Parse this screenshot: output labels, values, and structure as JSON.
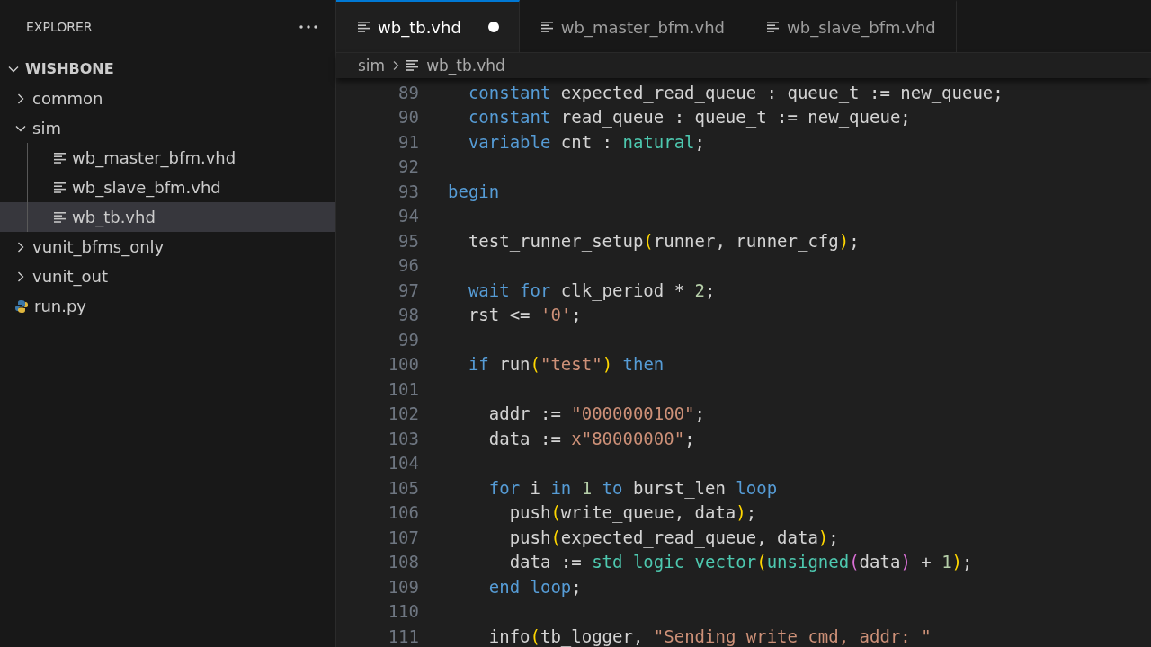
{
  "sidebar": {
    "title": "EXPLORER",
    "tree": {
      "label": "WISHBONE",
      "kind": "root",
      "expanded": true,
      "selected": false,
      "children": [
        {
          "label": "common",
          "kind": "folder",
          "expanded": false,
          "selected": false
        },
        {
          "label": "sim",
          "kind": "folder",
          "expanded": true,
          "selected": false,
          "children": [
            {
              "label": "wb_master_bfm.vhd",
              "kind": "file",
              "selected": false
            },
            {
              "label": "wb_slave_bfm.vhd",
              "kind": "file",
              "selected": false
            },
            {
              "label": "wb_tb.vhd",
              "kind": "file",
              "selected": true
            }
          ]
        },
        {
          "label": "vunit_bfms_only",
          "kind": "folder",
          "expanded": false,
          "selected": false
        },
        {
          "label": "vunit_out",
          "kind": "folder",
          "expanded": false,
          "selected": false
        },
        {
          "label": "run.py",
          "kind": "python",
          "selected": false
        }
      ]
    }
  },
  "tabs": [
    {
      "label": "wb_tb.vhd",
      "selected": true,
      "modified": true
    },
    {
      "label": "wb_master_bfm.vhd",
      "selected": false,
      "modified": false
    },
    {
      "label": "wb_slave_bfm.vhd",
      "selected": false,
      "modified": false
    }
  ],
  "breadcrumb": [
    "sim",
    "wb_tb.vhd"
  ],
  "editor": {
    "lines": [
      {
        "number": "89",
        "tokens": [
          {
            "kind": "keyword",
            "text": "  constant"
          },
          {
            "kind": "plain",
            "text": " expected_read_queue : queue_t := new_queue;"
          }
        ]
      },
      {
        "number": "90",
        "tokens": [
          {
            "kind": "keyword",
            "text": "  constant"
          },
          {
            "kind": "plain",
            "text": " read_queue : queue_t := new_queue;"
          }
        ]
      },
      {
        "number": "91",
        "tokens": [
          {
            "kind": "keyword",
            "text": "  variable"
          },
          {
            "kind": "plain",
            "text": " cnt : "
          },
          {
            "kind": "type",
            "text": "natural"
          },
          {
            "kind": "plain",
            "text": ";"
          }
        ]
      },
      {
        "number": "92"
      },
      {
        "number": "93",
        "tokens": [
          {
            "kind": "keyword",
            "text": "begin"
          }
        ]
      },
      {
        "number": "94"
      },
      {
        "number": "95",
        "tokens": [
          {
            "kind": "plain",
            "text": "  test_runner_setup"
          },
          {
            "kind": "paren",
            "text": "("
          },
          {
            "kind": "plain",
            "text": "runner, runner_cfg"
          },
          {
            "kind": "paren",
            "text": ")"
          },
          {
            "kind": "plain",
            "text": ";"
          }
        ]
      },
      {
        "number": "96"
      },
      {
        "number": "97",
        "tokens": [
          {
            "kind": "keyword",
            "text": "  wait for"
          },
          {
            "kind": "plain",
            "text": " clk_period * "
          },
          {
            "kind": "number",
            "text": "2"
          },
          {
            "kind": "plain",
            "text": ";"
          }
        ]
      },
      {
        "number": "98",
        "tokens": [
          {
            "kind": "plain",
            "text": "  rst <= "
          },
          {
            "kind": "string",
            "text": "'0'"
          },
          {
            "kind": "plain",
            "text": ";"
          }
        ]
      },
      {
        "number": "99"
      },
      {
        "number": "100",
        "tokens": [
          {
            "kind": "keyword",
            "text": "  if"
          },
          {
            "kind": "plain",
            "text": " run"
          },
          {
            "kind": "paren",
            "text": "("
          },
          {
            "kind": "string",
            "text": "\"test\""
          },
          {
            "kind": "paren",
            "text": ")"
          },
          {
            "kind": "keyword",
            "text": " then"
          }
        ]
      },
      {
        "number": "101"
      },
      {
        "number": "102",
        "tokens": [
          {
            "kind": "plain",
            "text": "    addr := "
          },
          {
            "kind": "string",
            "text": "\"0000000100\""
          },
          {
            "kind": "plain",
            "text": ";"
          }
        ]
      },
      {
        "number": "103",
        "tokens": [
          {
            "kind": "plain",
            "text": "    data := "
          },
          {
            "kind": "string",
            "text": "x\"80000000\""
          },
          {
            "kind": "plain",
            "text": ";"
          }
        ]
      },
      {
        "number": "104"
      },
      {
        "number": "105",
        "tokens": [
          {
            "kind": "keyword",
            "text": "    for"
          },
          {
            "kind": "plain",
            "text": " i "
          },
          {
            "kind": "keyword",
            "text": "in"
          },
          {
            "kind": "number",
            "text": " 1"
          },
          {
            "kind": "keyword",
            "text": " to"
          },
          {
            "kind": "plain",
            "text": " burst_len "
          },
          {
            "kind": "keyword",
            "text": "loop"
          }
        ]
      },
      {
        "number": "106",
        "tokens": [
          {
            "kind": "plain",
            "text": "      push"
          },
          {
            "kind": "paren",
            "text": "("
          },
          {
            "kind": "plain",
            "text": "write_queue, data"
          },
          {
            "kind": "paren",
            "text": ")"
          },
          {
            "kind": "plain",
            "text": ";"
          }
        ]
      },
      {
        "number": "107",
        "tokens": [
          {
            "kind": "plain",
            "text": "      push"
          },
          {
            "kind": "paren",
            "text": "("
          },
          {
            "kind": "plain",
            "text": "expected_read_queue, data"
          },
          {
            "kind": "paren",
            "text": ")"
          },
          {
            "kind": "plain",
            "text": ";"
          }
        ]
      },
      {
        "number": "108",
        "tokens": [
          {
            "kind": "plain",
            "text": "      data := "
          },
          {
            "kind": "type",
            "text": "std_logic_vector"
          },
          {
            "kind": "paren",
            "text": "("
          },
          {
            "kind": "type",
            "text": "unsigned"
          },
          {
            "kind": "paren2",
            "text": "("
          },
          {
            "kind": "plain",
            "text": "data"
          },
          {
            "kind": "paren2",
            "text": ")"
          },
          {
            "kind": "plain",
            "text": " + "
          },
          {
            "kind": "number",
            "text": "1"
          },
          {
            "kind": "paren",
            "text": ")"
          },
          {
            "kind": "plain",
            "text": ";"
          }
        ]
      },
      {
        "number": "109",
        "tokens": [
          {
            "kind": "keyword",
            "text": "    end loop"
          },
          {
            "kind": "plain",
            "text": ";"
          }
        ]
      },
      {
        "number": "110"
      },
      {
        "number": "111",
        "tokens": [
          {
            "kind": "plain",
            "text": "    info"
          },
          {
            "kind": "paren",
            "text": "("
          },
          {
            "kind": "plain",
            "text": "tb_logger, "
          },
          {
            "kind": "string",
            "text": "\"Sending write cmd, addr: \""
          }
        ]
      }
    ]
  }
}
